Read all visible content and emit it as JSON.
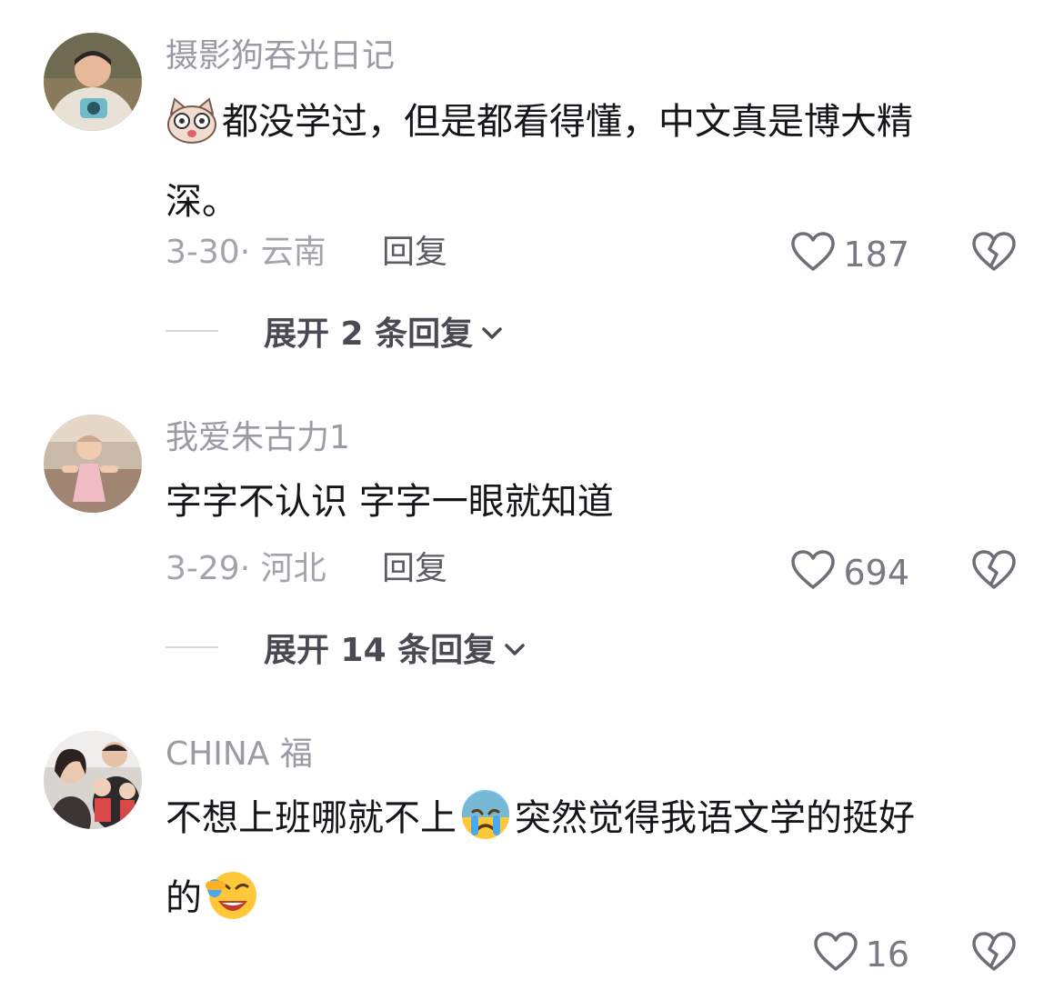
{
  "comments": [
    {
      "username": "摄影狗吞光日记",
      "text_line1": "都没学过，但是都看得懂，中文真是博大精",
      "text_line2": "深。",
      "emoji": "cat-face-emoji",
      "date_location": "3-30· 云南",
      "reply_label": "回复",
      "like_count": "187",
      "expand_label": "展开 2 条回复"
    },
    {
      "username": "我爱朱古力1",
      "text_line1": "字字不认识 字字一眼就知道",
      "date_location": "3-29· 河北",
      "reply_label": "回复",
      "like_count": "694",
      "expand_label": "展开 14 条回复"
    },
    {
      "username": "CHINA 福",
      "text_part1": "不想上班哪就不上",
      "emoji1": "crying-face-emoji",
      "text_part2": "突然觉得我语文学的挺好",
      "text_line2": "的",
      "emoji2": "laughing-face-emoji",
      "like_count": "16"
    }
  ],
  "colors": {
    "username": "#9b9ba3",
    "body_text": "#16161a",
    "meta": "#a3a3aa",
    "icon": "#6e6e76"
  }
}
